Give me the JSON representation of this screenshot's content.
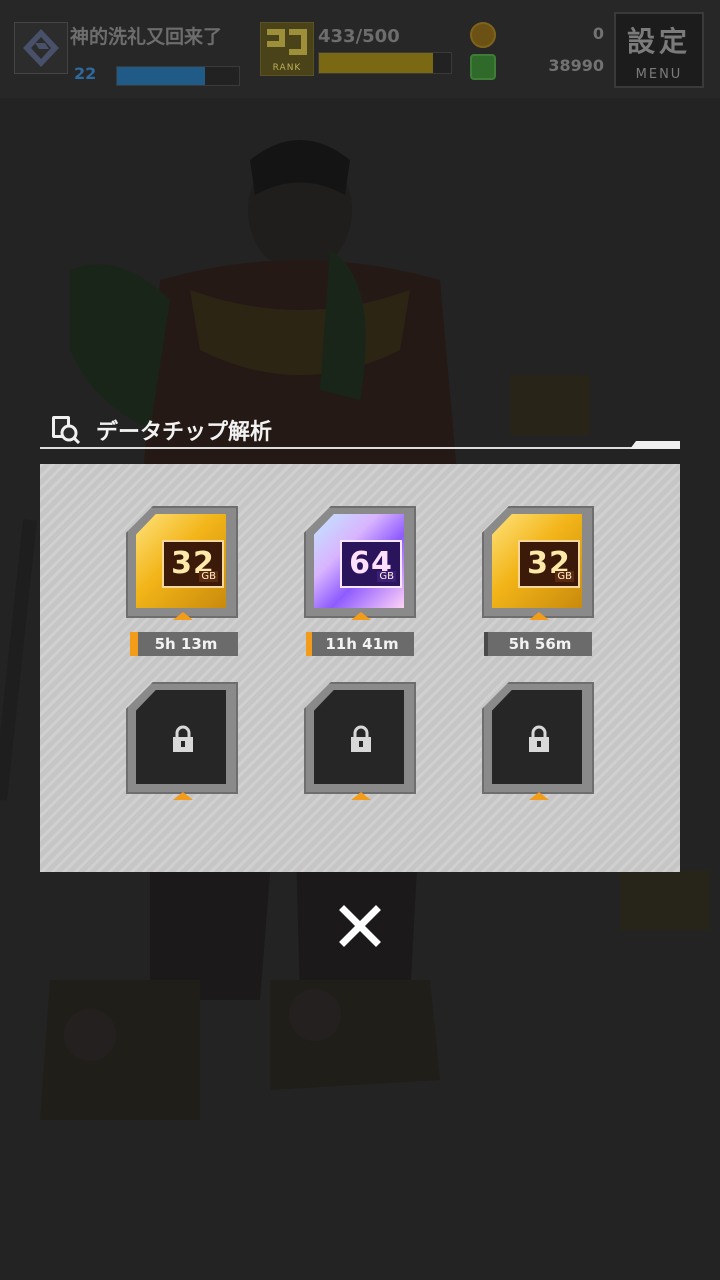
{
  "hud": {
    "player_name": "神的洗礼又回来了",
    "player_level": "22",
    "exp_fraction": 0.72,
    "rank_label": "RANK",
    "stamina_text": "433/500",
    "stamina_fraction": 0.866,
    "coins": "0",
    "gems": "38990",
    "menu_kanji": "設定",
    "menu_label": "MENU"
  },
  "dialog": {
    "title": "データチップ解析",
    "slots": [
      {
        "state": "chip",
        "kind": "gold",
        "capacity": "32",
        "unit": "GB",
        "timer": "5h 13m",
        "progress": 0.06
      },
      {
        "state": "chip",
        "kind": "prism",
        "capacity": "64",
        "unit": "GB",
        "timer": "11h 41m",
        "progress": 0.02
      },
      {
        "state": "chip",
        "kind": "gold",
        "capacity": "32",
        "unit": "GB",
        "timer": "5h 56m",
        "progress": 0.0
      },
      {
        "state": "locked"
      },
      {
        "state": "locked"
      },
      {
        "state": "locked"
      }
    ]
  },
  "colors": {
    "accent_orange": "#f39c1a",
    "panel_bg": "#cccccc"
  }
}
